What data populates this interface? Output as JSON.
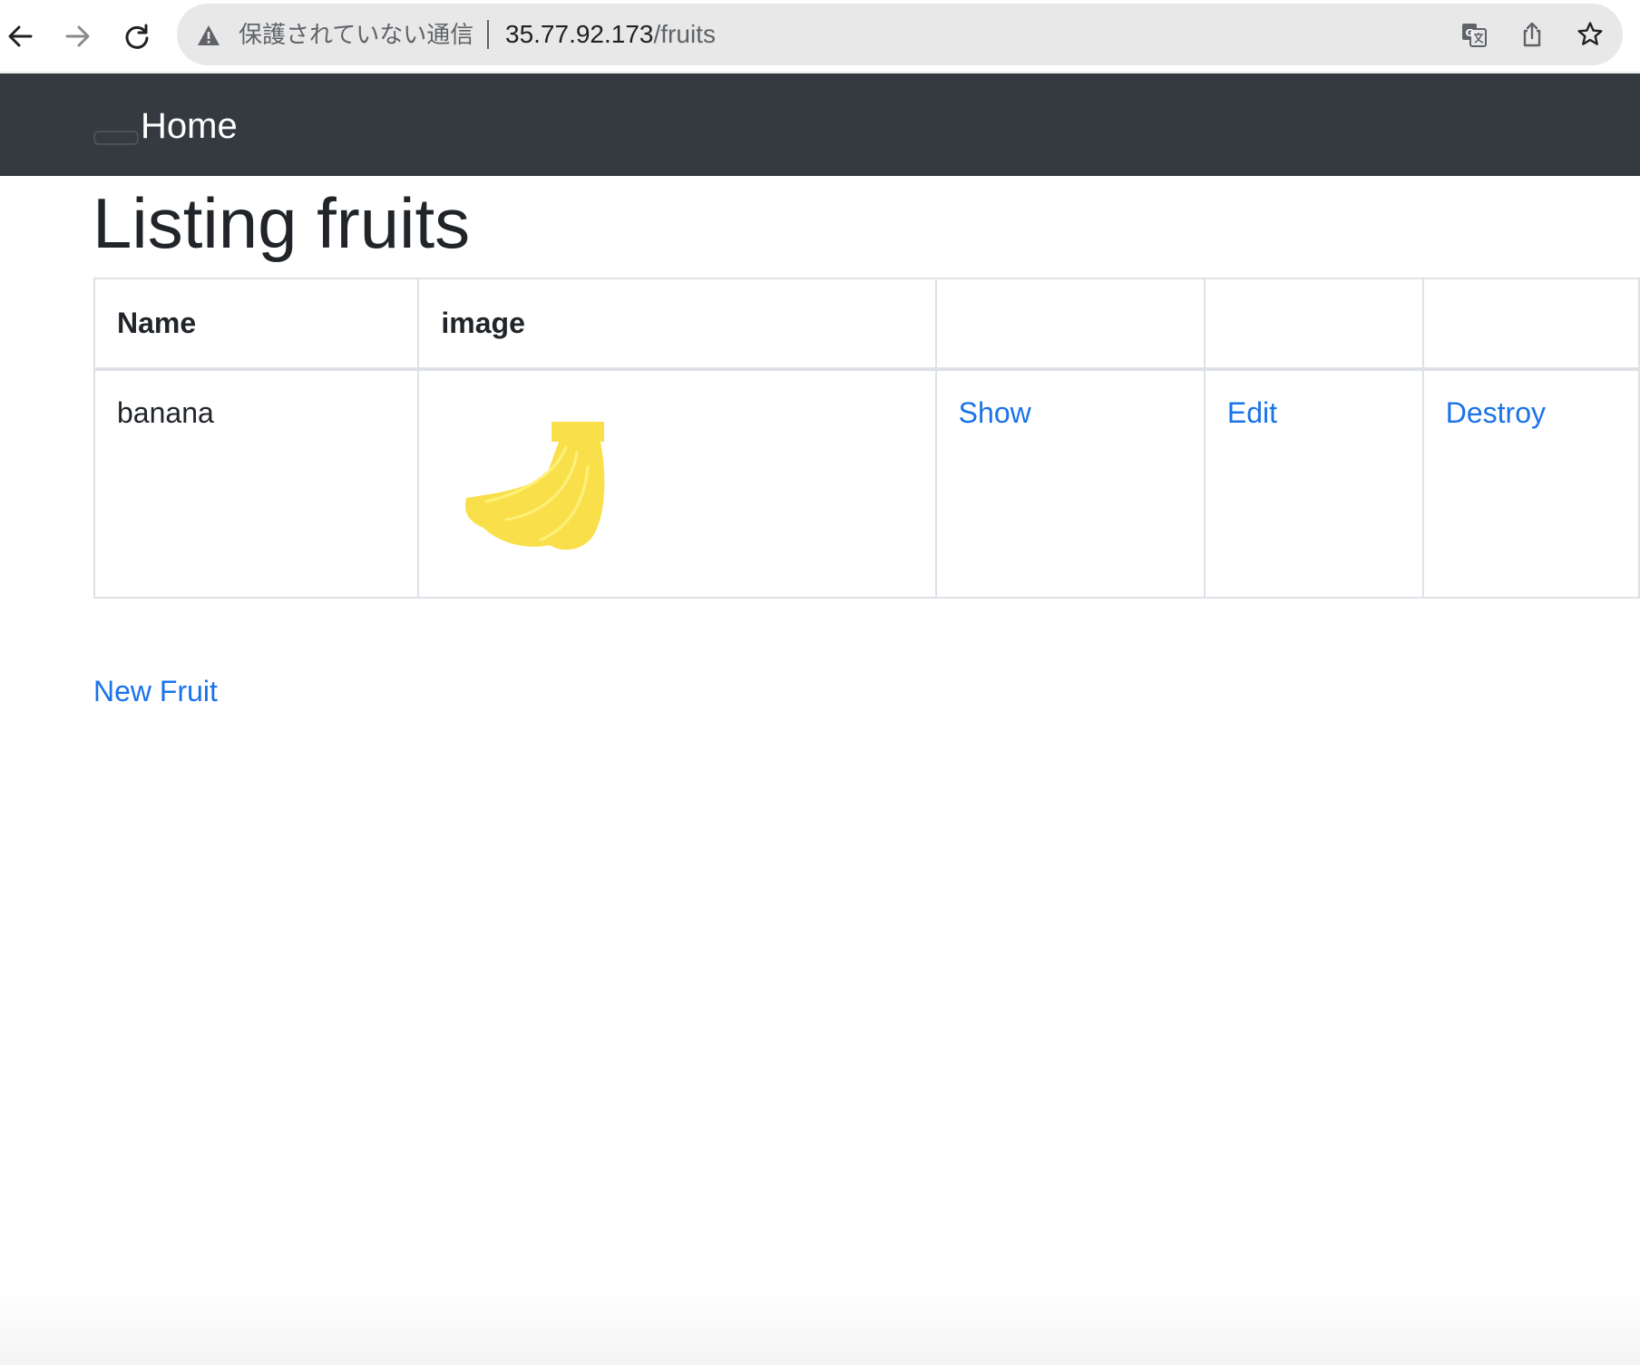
{
  "browser": {
    "security_text": "保護されていない通信",
    "url_host": "35.77.92.173",
    "url_path": "/fruits",
    "icons": [
      "back-arrow-icon",
      "forward-arrow-icon",
      "reload-icon",
      "warning-icon",
      "translate-icon",
      "share-icon",
      "bookmark-star-icon"
    ]
  },
  "navbar": {
    "brand": "Home"
  },
  "page": {
    "title": "Listing fruits",
    "table": {
      "headers": [
        "Name",
        "image",
        "",
        "",
        ""
      ],
      "rows": [
        {
          "name": "banana",
          "image_icon": "banana-icon",
          "show": "Show",
          "edit": "Edit",
          "destroy": "Destroy"
        }
      ]
    },
    "new_link": "New Fruit"
  },
  "colors": {
    "navbar_bg": "#343a40",
    "link": "#1a73e8",
    "banana": "#f9e04b"
  }
}
